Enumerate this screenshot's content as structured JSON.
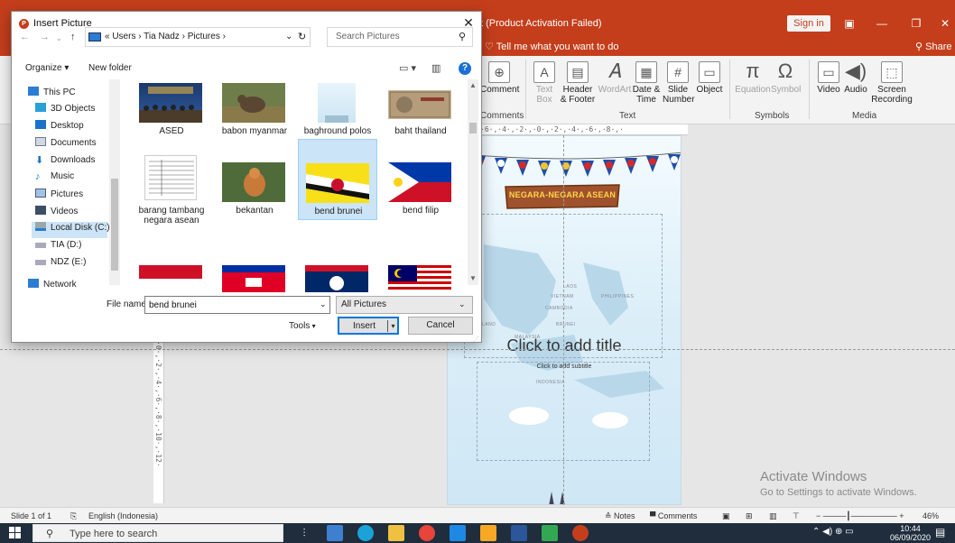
{
  "ppt": {
    "title": "t (Product Activation Failed)",
    "sign_in": "Sign in",
    "tell_me": "Tell me what you want to do",
    "share": "Share",
    "ribbon": {
      "comment": "Comment",
      "comments_group": "Comments",
      "text_box_1": "Text",
      "text_box_2": "Box",
      "header_footer_1": "Header",
      "header_footer_2": "& Footer",
      "wordart": "WordArt",
      "date_time_1": "Date &",
      "date_time_2": "Time",
      "slide_number_1": "Slide",
      "slide_number_2": "Number",
      "object": "Object",
      "text_group": "Text",
      "equation": "Equation",
      "symbol": "Symbol",
      "symbols_group": "Symbols",
      "video": "Video",
      "audio": "Audio",
      "screen_recording_1": "Screen",
      "screen_recording_2": "Recording",
      "media_group": "Media"
    },
    "slide": {
      "banner": "NEGARA-NEGARA ASEAN",
      "title_placeholder": "Click to add title",
      "subtitle_placeholder": "Click to add subtitle",
      "map_labels": [
        "LAOS",
        "VIETNAM",
        "CAMBODIA",
        "PHILIPPINES",
        "LAND",
        "BRUNEI",
        "MALAYSIA",
        "INDONESIA"
      ]
    },
    "watermark_1": "Activate Windows",
    "watermark_2": "Go to Settings to activate Windows.",
    "status": {
      "slide": "Slide 1 of 1",
      "language": "English (Indonesia)",
      "notes": "Notes",
      "comments": "Comments",
      "zoom": "46%"
    }
  },
  "taskbar": {
    "search_placeholder": "Type here to search",
    "time": "10:44",
    "date": "06/09/2020"
  },
  "dialog": {
    "title": "Insert Picture",
    "path": "« Users  ›  Tia Nadz  ›  Pictures  ›",
    "search_placeholder": "Search Pictures",
    "organize": "Organize ▾",
    "new_folder": "New folder",
    "nav_items": [
      "This PC",
      "3D Objects",
      "Desktop",
      "Documents",
      "Downloads",
      "Music",
      "Pictures",
      "Videos",
      "Local Disk (C:)",
      "TIA (D:)",
      "NDZ (E:)",
      "Network"
    ],
    "files": [
      {
        "name": "ASED"
      },
      {
        "name": "babon myanmar"
      },
      {
        "name": "baghround polos"
      },
      {
        "name": "baht thailand"
      },
      {
        "name": "barang tambang negara asean"
      },
      {
        "name": "bekantan"
      },
      {
        "name": "bend brunei"
      },
      {
        "name": "bend filip"
      }
    ],
    "file_name_label": "File name:",
    "file_name_value": "bend brunei",
    "filter": "All Pictures",
    "tools": "Tools",
    "insert": "Insert",
    "cancel": "Cancel"
  },
  "colors": {
    "accent": "#c43e1c",
    "selection": "#cce4f7",
    "taskbar": "#1f2d3d"
  }
}
